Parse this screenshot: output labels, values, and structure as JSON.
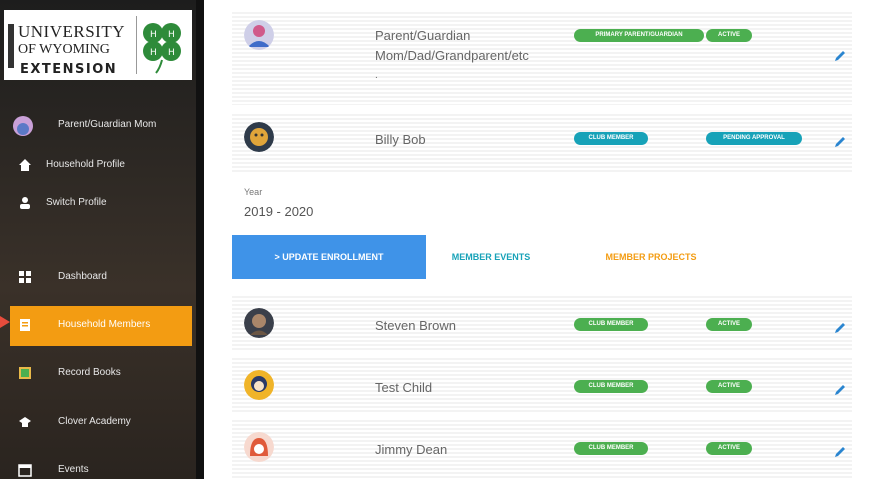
{
  "sidebar": {
    "logo": {
      "line1": "UNIVERSITY",
      "line2": "OF WYOMING",
      "line3": "EXTENSION"
    },
    "items": [
      {
        "label": "Parent/Guardian Mom",
        "icon": "user-avatar"
      },
      {
        "label": "Household Profile",
        "icon": "home-icon"
      },
      {
        "label": "Switch Profile",
        "icon": "person-icon"
      },
      {
        "label": "Dashboard",
        "icon": "dashboard-icon"
      },
      {
        "label": "Household Members",
        "icon": "members-icon",
        "active": true
      },
      {
        "label": "Record Books",
        "icon": "book-icon"
      },
      {
        "label": "Clover Academy",
        "icon": "graduation-cap-icon"
      },
      {
        "label": "Events",
        "icon": "calendar-icon"
      }
    ]
  },
  "household": [
    {
      "name": "Parent/Guardian",
      "subtitle": "Mom/Dad/Grandparent/etc",
      "extra": ".",
      "badges": [
        "PRIMARY PARENT/GUARDIAN",
        "ACTIVE"
      ]
    },
    {
      "name": "Billy Bob",
      "badges": [
        "CLUB MEMBER",
        "PENDING APPROVAL"
      ]
    }
  ],
  "year": {
    "label": "Year",
    "value": "2019 - 2020"
  },
  "tabs": {
    "update": "> UPDATE ENROLLMENT",
    "events": "MEMBER EVENTS",
    "projects": "MEMBER PROJECTS"
  },
  "members": [
    {
      "name": "Steven Brown",
      "badges": [
        "CLUB MEMBER",
        "ACTIVE"
      ]
    },
    {
      "name": "Test Child",
      "badges": [
        "CLUB MEMBER",
        "ACTIVE"
      ]
    },
    {
      "name": "Jimmy Dean",
      "badges": [
        "CLUB MEMBER",
        "ACTIVE"
      ]
    }
  ],
  "colors": {
    "accent": "#f39c12",
    "primary": "#3f93e8",
    "active": "#4caf50",
    "info": "#17a2b8"
  }
}
